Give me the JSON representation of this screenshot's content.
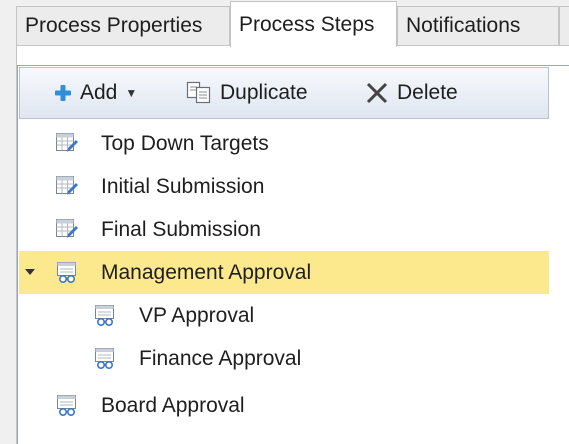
{
  "tabs": [
    {
      "label": "Process Properties",
      "active": false
    },
    {
      "label": "Process Steps",
      "active": true
    },
    {
      "label": "Notifications",
      "active": false
    }
  ],
  "toolbar": {
    "add_label": "Add",
    "duplicate_label": "Duplicate",
    "delete_label": "Delete"
  },
  "tree": {
    "items": [
      {
        "label": "Top Down Targets",
        "icon": "form-edit-icon",
        "level": 0
      },
      {
        "label": "Initial Submission",
        "icon": "form-edit-icon",
        "level": 0
      },
      {
        "label": "Final Submission",
        "icon": "form-edit-icon",
        "level": 0
      },
      {
        "label": "Management Approval",
        "icon": "approval-review-icon",
        "level": 0,
        "expanded": true,
        "selected": true
      },
      {
        "label": "VP Approval",
        "icon": "approval-review-icon",
        "level": 1
      },
      {
        "label": "Finance Approval",
        "icon": "approval-review-icon",
        "level": 1
      },
      {
        "label": "Board Approval",
        "icon": "approval-review-icon",
        "level": 0
      }
    ]
  },
  "colors": {
    "selection": "#fde98d",
    "add_plus": "#2f8fd8",
    "toolbar_border": "#b6c3d6"
  }
}
